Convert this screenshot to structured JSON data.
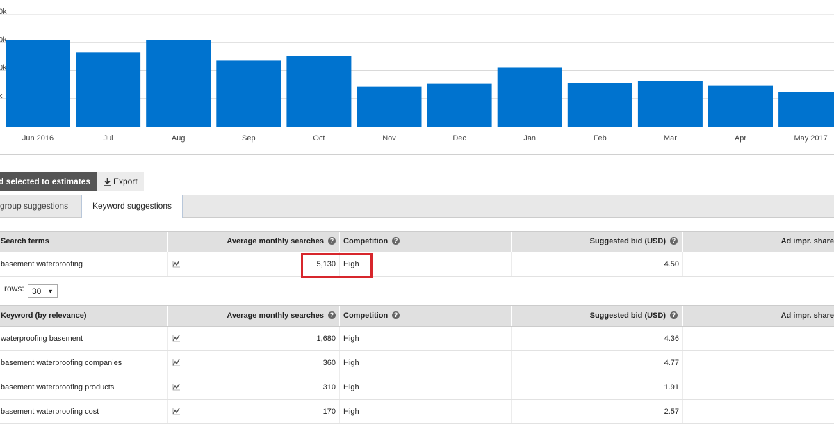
{
  "chart_data": {
    "type": "bar",
    "categories": [
      "Jun 2016",
      "Jul",
      "Aug",
      "Sep",
      "Oct",
      "Nov",
      "Dec",
      "Jan",
      "Feb",
      "Mar",
      "Apr",
      "May 2017"
    ],
    "values": [
      6200,
      5300,
      6200,
      4700,
      5050,
      2850,
      3050,
      4200,
      3100,
      3250,
      2950,
      2450
    ],
    "ylim": [
      0,
      8000
    ],
    "y_ticks": [
      {
        "value": 8000,
        "label": "0k"
      },
      {
        "value": 6000,
        "label": "0k"
      },
      {
        "value": 4000,
        "label": "0k"
      },
      {
        "value": 2000,
        "label": "k"
      }
    ],
    "grid": true,
    "colors": {
      "bar": "#0073cf"
    }
  },
  "toolbar": {
    "add_label": "d selected to estimates",
    "export_label": "Export",
    "export_icon": "download-icon"
  },
  "tabs": {
    "group": "group suggestions",
    "keyword": "Keyword suggestions"
  },
  "search_table": {
    "headers": {
      "term": "Search terms",
      "avg": "Average monthly searches",
      "competition": "Competition",
      "bid": "Suggested bid (USD)",
      "ad": "Ad impr. share"
    },
    "row": {
      "keyword": "basement waterproofing",
      "avg": "5,130",
      "competition": "High",
      "bid": "4.50"
    }
  },
  "rows_control": {
    "label": "rows:",
    "value": "30"
  },
  "keyword_table": {
    "headers": {
      "term": "Keyword (by relevance)",
      "avg": "Average monthly searches",
      "competition": "Competition",
      "bid": "Suggested bid (USD)",
      "ad": "Ad impr. share"
    },
    "rows": [
      {
        "keyword": "waterproofing basement",
        "avg": "1,680",
        "competition": "High",
        "bid": "4.36"
      },
      {
        "keyword": "basement waterproofing companies",
        "avg": "360",
        "competition": "High",
        "bid": "4.77"
      },
      {
        "keyword": "basement waterproofing products",
        "avg": "310",
        "competition": "High",
        "bid": "1.91"
      },
      {
        "keyword": "basement waterproofing cost",
        "avg": "170",
        "competition": "High",
        "bid": "2.57"
      }
    ]
  },
  "highlight_color": "#d7262c"
}
